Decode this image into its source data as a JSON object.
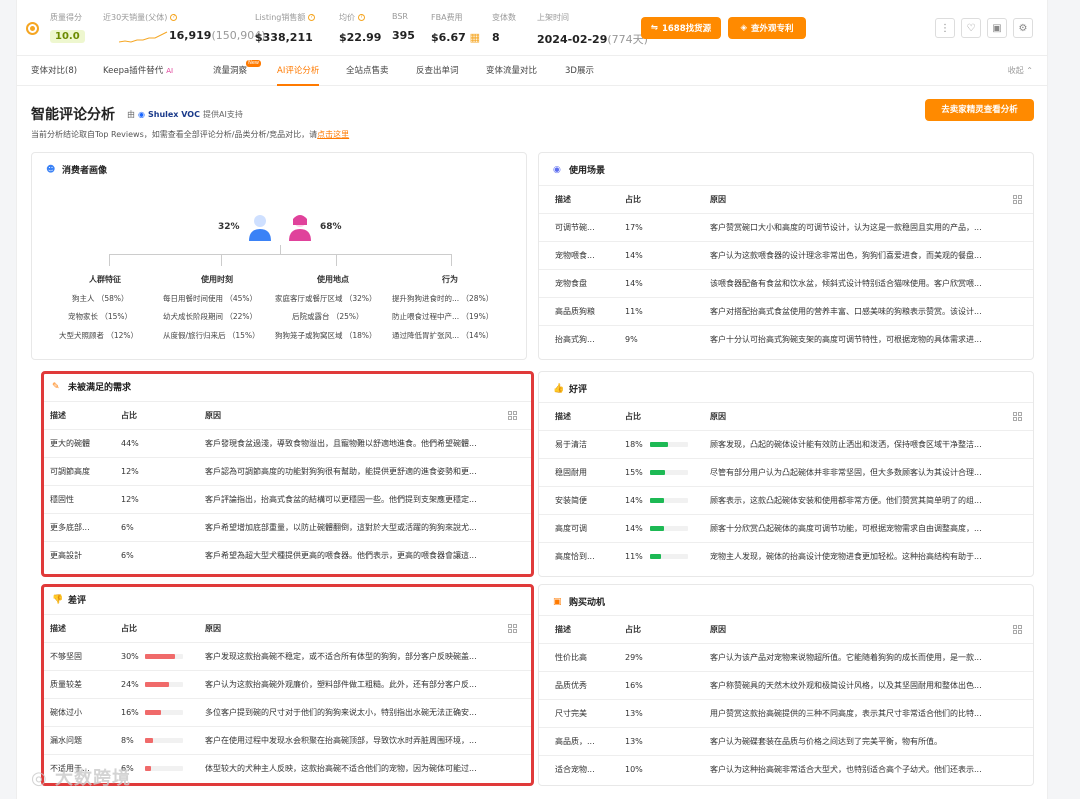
{
  "metrics": {
    "quality": {
      "label": "质量得分",
      "value": "10.0"
    },
    "sales30": {
      "label": "近30天销量(父体)",
      "value": "16,919",
      "sub": "(150,904)"
    },
    "listing_sales": {
      "label": "Listing销售额",
      "value": "$338,211"
    },
    "avg_price": {
      "label": "均价",
      "value": "$22.99"
    },
    "bsr": {
      "label": "BSR",
      "value": "395"
    },
    "fba": {
      "label": "FBA费用",
      "value": "$6.67"
    },
    "variants": {
      "label": "变体数",
      "value": "8"
    },
    "launch": {
      "label": "上架时间",
      "value": "2024-02-29",
      "sub": "(774天)"
    }
  },
  "buttons": {
    "source_1688": "1688找货源",
    "patent": "查外观专利",
    "seller_analysis": "去卖家精灵查看分析"
  },
  "tabs": [
    {
      "label": "变体对比(8)"
    },
    {
      "label": "Keepa插件替代",
      "badge": "AI"
    },
    {
      "label": "流量洞察",
      "badge": "New"
    },
    {
      "label": "AI评论分析",
      "active": true
    },
    {
      "label": "全站点售卖"
    },
    {
      "label": "反查出单词"
    },
    {
      "label": "变体流量对比"
    },
    {
      "label": "3D展示"
    }
  ],
  "collapse_label": "收起",
  "heading": {
    "title": "智能评论分析",
    "by_prefix": "由",
    "by_brand": "Shulex VOC",
    "by_suffix": "提供AI支持",
    "desc": "当前分析结论取自Top Reviews，如需查看全部评论分析/品类分析/竞品对比，请",
    "desc_link": "点击这里"
  },
  "consumer": {
    "title": "消费者画像",
    "male_pct": "32%",
    "female_pct": "68%",
    "columns": [
      {
        "head": "人群特征",
        "items": [
          "狗主人 （58%）",
          "宠物家长 （15%）",
          "大型犬照顾者 （12%）"
        ]
      },
      {
        "head": "使用时刻",
        "items": [
          "每日用餐时间使用 （45%）",
          "幼犬成长阶段期间 （22%）",
          "从度假/旅行归来后 （15%）"
        ]
      },
      {
        "head": "使用地点",
        "items": [
          "家庭客厅或餐厅区域 （32%）",
          "后院或露台 （25%）",
          "狗狗笼子或狗窝区域 （18%）"
        ]
      },
      {
        "head": "行为",
        "items": [
          "提升狗狗进食时的... （28%）",
          "防止喂食过程中产... （19%）",
          "通过降低胃扩张风... （14%）"
        ]
      }
    ]
  },
  "table_headers": {
    "desc": "描述",
    "ratio": "占比",
    "reason": "原因"
  },
  "scenes": {
    "title": "使用场景",
    "rows": [
      {
        "desc": "可调节碗...",
        "ratio": "17%",
        "reason": "客户赞赏碗口大小和高度的可调节设计，认为这是一款稳固且实用的产品，..."
      },
      {
        "desc": "宠物喂食...",
        "ratio": "14%",
        "reason": "客户认为这款喂食器的设计理念非常出色，狗狗们喜爱进食，而美观的餐盘..."
      },
      {
        "desc": "宠物食盘",
        "ratio": "14%",
        "reason": "该喂食器配备有食盆和饮水盆，倾斜式设计特别适合猫咪使用。客户欣赏喂..."
      },
      {
        "desc": "高品质狗粮",
        "ratio": "11%",
        "reason": "客户对搭配抬高式食盆使用的营养丰富、口感美味的狗粮表示赞赏。该设计..."
      },
      {
        "desc": "抬高式狗...",
        "ratio": "9%",
        "reason": "客户十分认可抬高式狗碗支架的高度可调节特性，可根据宠物的具体需求进..."
      }
    ]
  },
  "unmet": {
    "title": "未被满足的需求",
    "rows": [
      {
        "desc": "更大的碗體",
        "ratio": "44%",
        "reason": "客戶發現食盆過淺，導致食物溢出，且寵物難以舒適地進食。他們希望碗體..."
      },
      {
        "desc": "可調節高度",
        "ratio": "12%",
        "reason": "客戶認為可調節高度的功能對狗狗很有幫助，能提供更舒適的進食姿勢和更..."
      },
      {
        "desc": "穩固性",
        "ratio": "12%",
        "reason": "客戶評論指出，抬高式食盆的結構可以更穩固一些。他們提到支架應更穩定..."
      },
      {
        "desc": "更多底部...",
        "ratio": "6%",
        "reason": "客戶希望增加底部重量，以防止碗體翻倒，這對於大型或活躍的狗狗來說尤..."
      },
      {
        "desc": "更高設計",
        "ratio": "6%",
        "reason": "客戶希望為超大型犬種提供更高的喂食器。他們表示，更高的喂食器會讓這..."
      }
    ]
  },
  "positive": {
    "title": "好评",
    "color": "#1db954",
    "rows": [
      {
        "desc": "易于清洁",
        "ratio": "18%",
        "pct": 18,
        "reason": "顾客发现，凸起的碗体设计能有效防止洒出和泼洒，保持喂食区域干净整洁..."
      },
      {
        "desc": "稳固耐用",
        "ratio": "15%",
        "pct": 15,
        "reason": "尽管有部分用户认为凸起碗体并非非常坚固，但大多数顾客认为其设计合理..."
      },
      {
        "desc": "安装简便",
        "ratio": "14%",
        "pct": 14,
        "reason": "顾客表示，这款凸起碗体安装和使用都非常方便。他们赞赏其简单明了的组..."
      },
      {
        "desc": "高度可调",
        "ratio": "14%",
        "pct": 14,
        "reason": "顾客十分欣赏凸起碗体的高度可调节功能，可根据宠物需求自由调整高度，..."
      },
      {
        "desc": "高度恰到...",
        "ratio": "11%",
        "pct": 11,
        "reason": "宠物主人发现，碗体的抬高设计使宠物进食更加轻松。这种抬高结构有助于..."
      }
    ]
  },
  "negative": {
    "title": "差评",
    "color": "#f06a6a",
    "rows": [
      {
        "desc": "不够坚固",
        "ratio": "30%",
        "pct": 30,
        "reason": "客户发现这款抬高碗不稳定，或不适合所有体型的狗狗，部分客户反映碗盖..."
      },
      {
        "desc": "质量较差",
        "ratio": "24%",
        "pct": 24,
        "reason": "客户认为这款抬高碗外观廉价，塑料部件做工粗糙。此外，还有部分客户反..."
      },
      {
        "desc": "碗体过小",
        "ratio": "16%",
        "pct": 16,
        "reason": "多位客户提到碗的尺寸对于他们的狗狗来说太小，特别指出水碗无法正确安..."
      },
      {
        "desc": "漏水问题",
        "ratio": "8%",
        "pct": 8,
        "reason": "客户在使用过程中发现水会积聚在抬高碗顶部，导致饮水时弄脏周围环境，..."
      },
      {
        "desc": "不适用于...",
        "ratio": "6%",
        "pct": 6,
        "reason": "体型较大的犬种主人反映，这款抬高碗不适合他们的宠物，因为碗体可能过..."
      }
    ]
  },
  "motive": {
    "title": "购买动机",
    "rows": [
      {
        "desc": "性价比高",
        "ratio": "29%",
        "reason": "客户认为该产品对宠物来说物超所值。它能随着狗狗的成长而使用，是一款..."
      },
      {
        "desc": "品质优秀",
        "ratio": "16%",
        "reason": "客户称赞碗具的天然木纹外观和极简设计风格，以及其坚固耐用和整体出色..."
      },
      {
        "desc": "尺寸完美",
        "ratio": "13%",
        "reason": "用户赞赏这款抬高碗提供的三种不同高度，表示其尺寸非常适合他们的比特..."
      },
      {
        "desc": "高品质，...",
        "ratio": "13%",
        "reason": "客户认为碗碟套装在品质与价格之间达到了完美平衡，物有所值。"
      },
      {
        "desc": "适合宠物...",
        "ratio": "10%",
        "reason": "客户认为这种抬高碗非常适合大型犬，也特别适合高个子幼犬。他们还表示..."
      }
    ]
  },
  "watermark": "大数跨境"
}
